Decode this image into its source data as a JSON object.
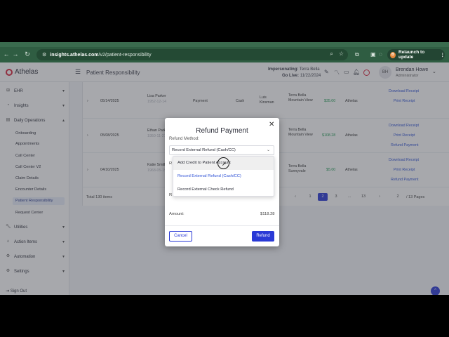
{
  "browser": {
    "url_host": "insights.athelas.com",
    "url_path": "/v2/patient-responsibility",
    "relaunch_label": "Relaunch to update",
    "relaunch_badge": "B"
  },
  "app": {
    "logo_text": "Athelas",
    "page_title": "Patient Responsibility",
    "impersonating_label": "Impersonating:",
    "impersonating_value": "Terra Bella",
    "golive_label": "Go Live:",
    "golive_value": "11/22/2024",
    "user_initials": "BH",
    "user_name": "Brendan Howe",
    "user_role": "Administrator"
  },
  "sidebar": {
    "sections": [
      {
        "label": "EHR",
        "icon": "ehr-icon"
      },
      {
        "label": "Insights",
        "icon": "insights-icon"
      },
      {
        "label": "Daily Operations",
        "icon": "operations-icon"
      }
    ],
    "items": [
      {
        "label": "Onboarding",
        "active": false
      },
      {
        "label": "Appointments",
        "active": false
      },
      {
        "label": "Call Center",
        "active": false
      },
      {
        "label": "Call Center V2",
        "active": false
      },
      {
        "label": "Claim Details",
        "active": false
      },
      {
        "label": "Encounter Details",
        "active": false
      },
      {
        "label": "Patient Responsibility",
        "active": true
      },
      {
        "label": "Request Center",
        "active": false
      }
    ],
    "bottom_sections": [
      {
        "label": "Utilities"
      },
      {
        "label": "Action Items"
      },
      {
        "label": "Automation"
      },
      {
        "label": "Settings"
      }
    ],
    "sign_out": "Sign Out"
  },
  "table": {
    "rows": [
      {
        "date": "05/14/2025",
        "name": "Lisa Parker",
        "sub": "1952-12-14",
        "type": "Payment",
        "method": "Cash",
        "staff": "Luis Kinsman",
        "location": "Terra Bella Mountain View",
        "amount": "$35.00",
        "company": "Athelas",
        "actions": [
          "Download Receipt",
          "Print Receipt"
        ]
      },
      {
        "date": "05/08/2025",
        "name": "Ethan Parker",
        "sub": "1950-11-21",
        "type": "",
        "method": "",
        "staff": "",
        "location": "Terra Bella Mountain View",
        "amount": "$108.28",
        "company": "Athelas",
        "actions": [
          "Download Receipt",
          "Print Receipt",
          "Refund Payment"
        ]
      },
      {
        "date": "04/10/2025",
        "name": "Katie Smith",
        "sub": "1968-05-19",
        "type": "",
        "method": "",
        "staff": "",
        "location": "Terra Bella Sunnyvale",
        "amount": "$5.00",
        "company": "Athelas",
        "actions": [
          "Download Receipt",
          "Print Receipt",
          "Refund Payment"
        ]
      }
    ],
    "total_label": "Total 130 items",
    "pages": [
      "1",
      "2",
      "3",
      "...",
      "13"
    ],
    "current_page": "2",
    "goto_value": "2",
    "page_size": "/ 13 Pages"
  },
  "modal": {
    "title": "Refund Payment",
    "refund_method_label": "Refund Method:",
    "selected_method": "Record External Refund (Cash/CC)",
    "options": [
      "Add Credit to Patient Account",
      "Record External Refund (Cash/CC)",
      "Record External Check Refund"
    ],
    "amount_label": "Amount:",
    "amount_value": "$118.28",
    "cancel_label": "Cancel",
    "refund_label": "Refund"
  },
  "colors": {
    "accent": "#2a3ad6",
    "brand": "#d8243b",
    "chrome": "#2f5d42"
  }
}
